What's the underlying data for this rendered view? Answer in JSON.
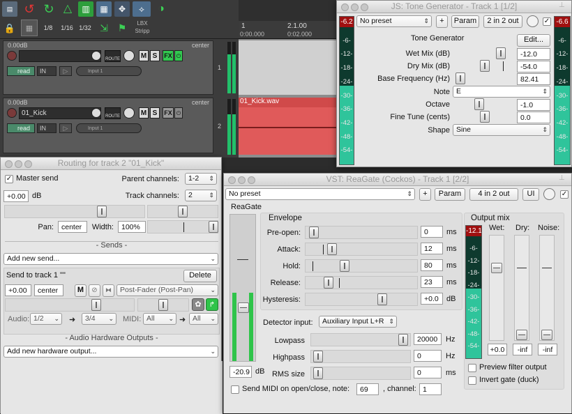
{
  "toolbar": {
    "grid_1_8": "1/8",
    "grid_1_16": "1/16",
    "grid_1_32": "1/32",
    "lbx_label_line1": "LBX",
    "lbx_label_line2": "Stripp"
  },
  "ruler": {
    "marker_1": "1",
    "time_1": "0:00.000",
    "marker_2": "2.1.00",
    "time_2": "0:02.000"
  },
  "tracks": [
    {
      "number": "1",
      "volume": "0.00dB",
      "pan": "center",
      "name": "",
      "mute": "M",
      "solo": "S",
      "fx": "FX",
      "route": "ROUTE",
      "automation": "read",
      "input_mode": "IN",
      "input": "Input 1"
    },
    {
      "number": "2",
      "volume": "0.00dB",
      "pan": "center",
      "name": "01_Kick",
      "mute": "M",
      "solo": "S",
      "fx": "FX",
      "route": "ROUTE",
      "automation": "read",
      "input_mode": "IN",
      "input": "Input 1"
    }
  ],
  "media_item": {
    "name": "01_Kick.wav"
  },
  "tone_generator": {
    "title": "JS: Tone Generator - Track 1 [1/2]",
    "preset": "No preset",
    "plus": "+",
    "param": "Param",
    "routing": "2 in 2 out",
    "in_meter_peak": "-6.2",
    "out_meter_peak": "-6.6",
    "meter_scale": [
      "-6-",
      "-12-",
      "-18-",
      "-24-",
      "-30-",
      "-36-",
      "-42-",
      "-48-",
      "-54-"
    ],
    "meter_level": 0.57,
    "plugin_name": "Tone Generator",
    "edit": "Edit...",
    "params": [
      {
        "label": "Wet Mix (dB)",
        "value": "-12.0"
      },
      {
        "label": "Dry Mix (dB)",
        "value": "-54.0"
      },
      {
        "label": "Base Frequency (Hz)",
        "value": "82.41"
      },
      {
        "label": "Note",
        "value": "E"
      },
      {
        "label": "Octave",
        "value": "-1.0"
      },
      {
        "label": "Fine Tune (cents)",
        "value": "0.0"
      },
      {
        "label": "Shape",
        "value": "Sine"
      }
    ]
  },
  "routing": {
    "title": "Routing for track 2 \"01_Kick\"",
    "master_send": "Master send",
    "parent_channels_label": "Parent channels:",
    "parent_channels": "1-2",
    "track_channels_label": "Track channels:",
    "track_channels": "2",
    "volume": "+0.00",
    "volume_unit": "dB",
    "pan_label": "Pan:",
    "pan": "center",
    "width_label": "Width:",
    "width": "100%",
    "sends_header": "- Sends -",
    "add_send": "Add new send...",
    "send_to": "Send to track 1 \"\"",
    "delete": "Delete",
    "send_volume": "+0.00",
    "send_pan": "center",
    "send_mute": "M",
    "send_mode": "Post-Fader (Post-Pan)",
    "audio_label": "Audio:",
    "audio_src": "1/2",
    "audio_arrow": "➜",
    "audio_dst": "3/4",
    "midi_label": "MIDI:",
    "midi_src": "All",
    "midi_arrow": "➜",
    "midi_dst": "All",
    "hw_header": "- Audio Hardware Outputs -",
    "add_hw": "Add new hardware output..."
  },
  "reagate": {
    "title": "VST: ReaGate (Cockos) - Track 1 [2/2]",
    "preset": "No preset",
    "plus": "+",
    "param": "Param",
    "routing": "4 in 2 out",
    "ui": "UI",
    "name": "ReaGate",
    "threshold_value": "-20.9",
    "threshold_unit": "dB",
    "envelope_header": "Envelope",
    "envelope": [
      {
        "label": "Pre-open:",
        "value": "0",
        "unit": "ms"
      },
      {
        "label": "Attack:",
        "value": "12",
        "unit": "ms"
      },
      {
        "label": "Hold:",
        "value": "80",
        "unit": "ms"
      },
      {
        "label": "Release:",
        "value": "23",
        "unit": "ms"
      },
      {
        "label": "Hysteresis:",
        "value": "+0.0",
        "unit": "dB"
      }
    ],
    "detector_label": "Detector input:",
    "detector_value": "Auxiliary Input L+R",
    "filters": [
      {
        "label": "Lowpass",
        "value": "20000",
        "unit": "Hz"
      },
      {
        "label": "Highpass",
        "value": "0",
        "unit": "Hz"
      },
      {
        "label": "RMS size",
        "value": "0",
        "unit": "ms"
      }
    ],
    "send_midi_label": "Send MIDI on open/close, note:",
    "midi_note": "69",
    "channel_label": ", channel:",
    "midi_channel": "1",
    "output_mix_header": "Output mix",
    "out_meter_peak": "-12.1",
    "meter_scale": [
      "-6-",
      "-12-",
      "-18-",
      "-24-",
      "-30-",
      "-36-",
      "-42-",
      "-48-",
      "-54-"
    ],
    "meter_level": 0.57,
    "wet_label": "Wet:",
    "dry_label": "Dry:",
    "noise_label": "Noise:",
    "wet_value": "+0.0",
    "dry_value": "-inf",
    "noise_value": "-inf",
    "preview_filter": "Preview filter output",
    "invert_gate": "Invert gate (duck)"
  }
}
